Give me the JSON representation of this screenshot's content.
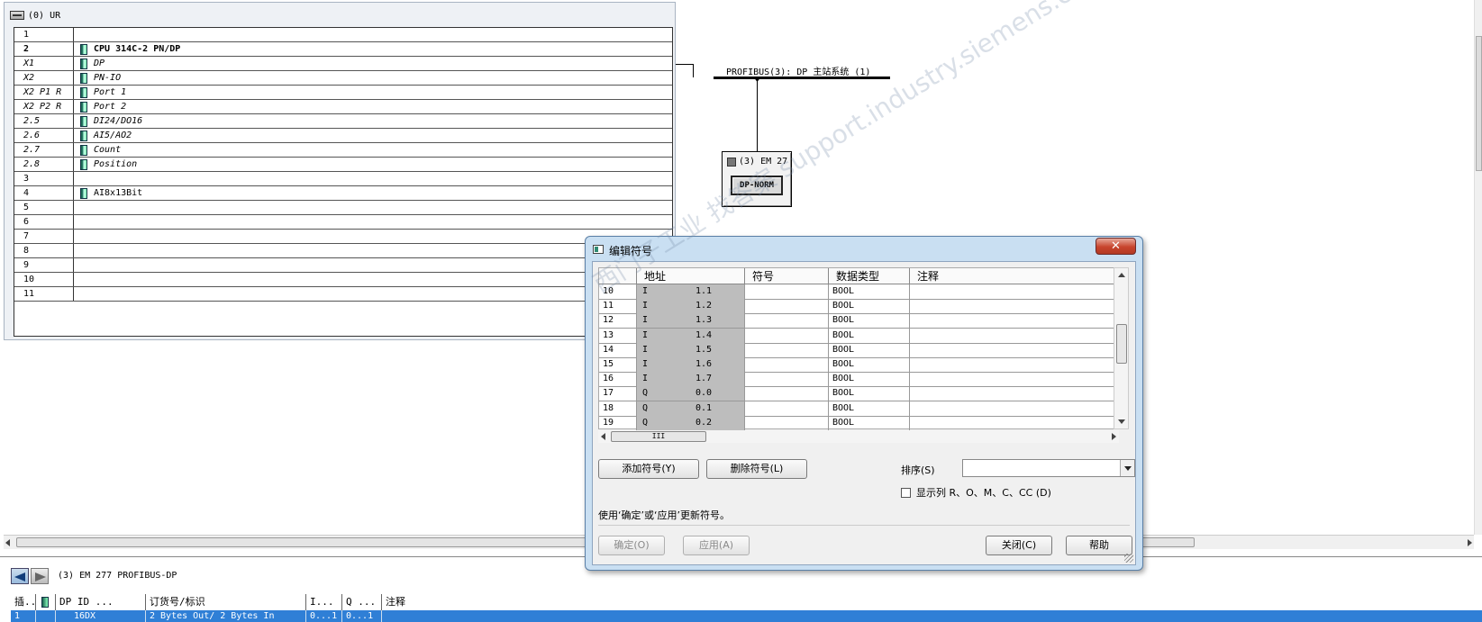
{
  "rack": {
    "title": "(0) UR",
    "rows": [
      {
        "slot": "1",
        "module": "",
        "style": "normal"
      },
      {
        "slot": "2",
        "module": "CPU 314C-2 PN/DP",
        "style": "bold"
      },
      {
        "slot": "X1",
        "module": "DP",
        "style": "italic"
      },
      {
        "slot": "X2",
        "module": "PN-IO",
        "style": "italic"
      },
      {
        "slot": "X2 P1 R",
        "module": "Port 1",
        "style": "italic"
      },
      {
        "slot": "X2 P2 R",
        "module": "Port 2",
        "style": "italic"
      },
      {
        "slot": "2.5",
        "module": "DI24/DO16",
        "style": "italic"
      },
      {
        "slot": "2.6",
        "module": "AI5/AO2",
        "style": "italic"
      },
      {
        "slot": "2.7",
        "module": "Count",
        "style": "italic"
      },
      {
        "slot": "2.8",
        "module": "Position",
        "style": "italic"
      },
      {
        "slot": "3",
        "module": "",
        "style": "normal"
      },
      {
        "slot": "4",
        "module": "AI8x13Bit",
        "style": "normal"
      },
      {
        "slot": "5",
        "module": "",
        "style": "normal"
      },
      {
        "slot": "6",
        "module": "",
        "style": "normal"
      },
      {
        "slot": "7",
        "module": "",
        "style": "normal"
      },
      {
        "slot": "8",
        "module": "",
        "style": "normal"
      },
      {
        "slot": "9",
        "module": "",
        "style": "normal"
      },
      {
        "slot": "10",
        "module": "",
        "style": "normal"
      },
      {
        "slot": "11",
        "module": "",
        "style": "normal"
      }
    ]
  },
  "network": {
    "profibus_label": "PROFIBUS(3): DP 主站系统 (1)",
    "device_title": "(3) EM 27",
    "device_button": "DP-NORM"
  },
  "detail": {
    "title": "(3)   EM 277 PROFIBUS-DP",
    "columns": [
      "插..",
      "",
      "DP ID   ...",
      "订货号/标识",
      "I...",
      "Q ...",
      "注释"
    ],
    "row": [
      "1",
      "",
      "16DX",
      "2 Bytes Out/ 2 Bytes In",
      "0...1",
      "0...1",
      ""
    ]
  },
  "dialog": {
    "title": "编辑符号",
    "close_label": "✕",
    "columns": [
      "",
      "地址",
      "符号",
      "数据类型",
      "注释"
    ],
    "rows": [
      {
        "num": "10",
        "type": "I",
        "addr": "1.1",
        "symbol": "",
        "dtype": "BOOL",
        "comment": ""
      },
      {
        "num": "11",
        "type": "I",
        "addr": "1.2",
        "symbol": "",
        "dtype": "BOOL",
        "comment": ""
      },
      {
        "num": "12",
        "type": "I",
        "addr": "1.3",
        "symbol": "",
        "dtype": "BOOL",
        "comment": ""
      },
      {
        "num": "13",
        "type": "I",
        "addr": "1.4",
        "symbol": "",
        "dtype": "BOOL",
        "comment": ""
      },
      {
        "num": "14",
        "type": "I",
        "addr": "1.5",
        "symbol": "",
        "dtype": "BOOL",
        "comment": ""
      },
      {
        "num": "15",
        "type": "I",
        "addr": "1.6",
        "symbol": "",
        "dtype": "BOOL",
        "comment": ""
      },
      {
        "num": "16",
        "type": "I",
        "addr": "1.7",
        "symbol": "",
        "dtype": "BOOL",
        "comment": ""
      },
      {
        "num": "17",
        "type": "Q",
        "addr": "0.0",
        "symbol": "",
        "dtype": "BOOL",
        "comment": ""
      },
      {
        "num": "18",
        "type": "Q",
        "addr": "0.1",
        "symbol": "",
        "dtype": "BOOL",
        "comment": ""
      },
      {
        "num": "19",
        "type": "Q",
        "addr": "0.2",
        "symbol": "",
        "dtype": "BOOL",
        "comment": ""
      }
    ],
    "hscroll_thumb_label": "III",
    "add_symbol": "添加符号(Y)",
    "delete_symbol": "删除符号(L)",
    "sort_label": "排序(S)",
    "sort_value": "",
    "show_columns": "显示列 R、O、M、C、CC (D)",
    "hint": "使用‘确定’或‘应用’更新符号。",
    "ok": "确定(O)",
    "apply": "应用(A)",
    "close": "关闭(C)",
    "help": "帮助"
  },
  "watermark": "西门子工业 找答案 support.industry.siemens.com/cs"
}
